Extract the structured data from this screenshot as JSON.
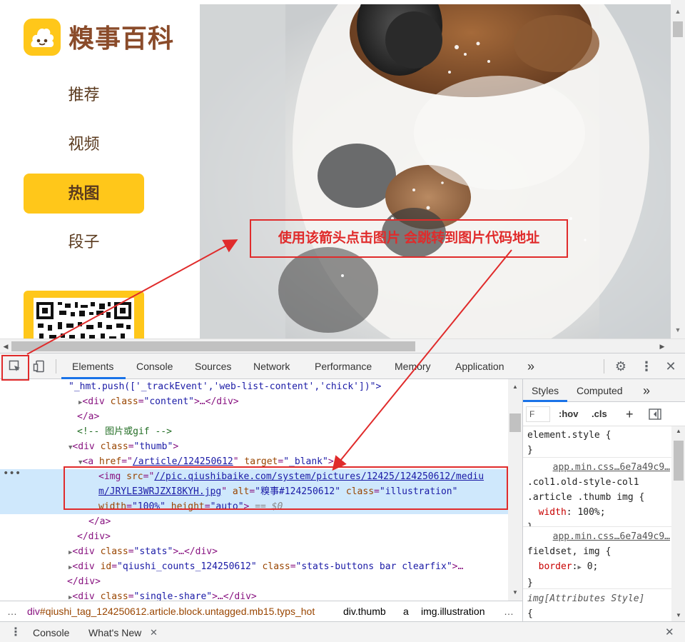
{
  "site": {
    "logo_text": "糗事百科",
    "nav": [
      {
        "label": "推荐",
        "active": false
      },
      {
        "label": "视频",
        "active": false
      },
      {
        "label": "热图",
        "active": true
      },
      {
        "label": "段子",
        "active": false
      }
    ]
  },
  "annotation": {
    "text": "使用该箭头点击图片  会跳转到图片代码地址"
  },
  "devtools": {
    "tabs": [
      "Elements",
      "Console",
      "Sources",
      "Network",
      "Performance",
      "Memory",
      "Application"
    ],
    "active_tab": "Elements",
    "more_tabs": "»",
    "elements_lines": {
      "l1": "\"_hmt.push(['_trackEvent','web-list-content','chick'])\">",
      "l2_tag": "<div",
      "l2_attr": "class",
      "l2_val": "\"content\"",
      "l2_rest": ">…</div>",
      "l3": "</a>",
      "l4": "<!-- 图片或gif -->",
      "l5_tag": "<div",
      "l5_attr": "class",
      "l5_val": "\"thumb\"",
      "l6_tag": "<a",
      "l6_href_attr": "href",
      "l6_href": "/article/124250612",
      "l6_target_attr": "target",
      "l6_target": "\"_blank\"",
      "l7_tag": "<img",
      "l7_src_attr": "src",
      "l7_src_1": "//pic.qiushibaike.com/system/pictures/12425/124250612/mediu",
      "l8_src_2": "m/JRYLE3WRJZXI8KYH.jpg",
      "l8_alt_attr": "alt",
      "l8_alt": "\"糗事#124250612\"",
      "l8_class_attr": "class",
      "l8_class": "\"illustration\"",
      "l9_w_attr": "width",
      "l9_w": "\"100%\"",
      "l9_h_attr": "height",
      "l9_h": "\"auto\"",
      "l9_dollar": "== $0",
      "l10": "</a>",
      "l11": "</div>",
      "l12_tag": "<div",
      "l12_attr": "class",
      "l12_val": "\"stats\"",
      "l12_rest": ">…</div>",
      "l13_tag": "<div",
      "l13_id_attr": "id",
      "l13_id": "\"qiushi_counts_124250612\"",
      "l13_class_attr": "class",
      "l13_class": "\"stats-buttons bar clearfix\"",
      "l13_rest": ">…",
      "l14": "</div>",
      "l15_tag": "<div",
      "l15_attr": "class",
      "l15_val": "\"single-share\"",
      "l15_rest": ">…</div>"
    },
    "breadcrumbs": {
      "ellipsis": "…",
      "c1_tag": "div",
      "c1_id": "#qiushi_tag_124250612",
      "c1_cls": ".article.block.untagged.mb15.typs_hot",
      "c2": "div.thumb",
      "c3": "a",
      "c4": "img.illustration",
      "c5": "…"
    },
    "styles": {
      "tabs": [
        "Styles",
        "Computed"
      ],
      "more": "»",
      "filter_placeholder": "F",
      "hov": ":hov",
      "cls": ".cls",
      "plus": "+",
      "rule1_sel": "element.style {",
      "rule1_end": "}",
      "rule2_src": "app.min.css…6e7a49c9…",
      "rule2_sel1": ".col1.old-style-col1",
      "rule2_sel2": ".article .thumb img {",
      "rule2_prop": "width",
      "rule2_val": "100%;",
      "rule2_end": "}",
      "rule3_src": "app.min.css…6e7a49c9…",
      "rule3_sel": "fieldset, img {",
      "rule3_prop": "border",
      "rule3_val": "0;",
      "rule3_end": "}",
      "rule4_sel": "img[Attributes Style]",
      "rule4_open": "{"
    },
    "drawer": {
      "tabs": [
        "Console",
        "What's New"
      ]
    }
  },
  "colors": {
    "brand_yellow": "#ffc71a",
    "annotation_red": "#e02b2b",
    "selection_blue": "#cfe8fc",
    "tab_accent": "#1a73e8"
  }
}
